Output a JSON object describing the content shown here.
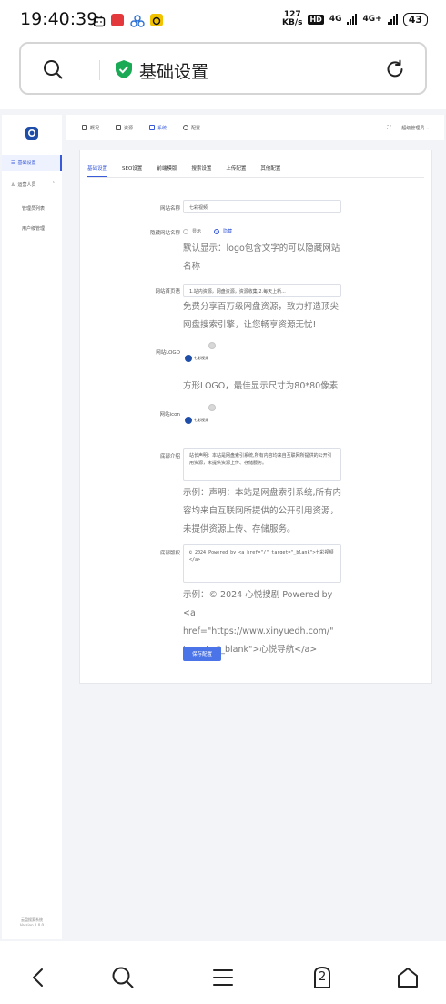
{
  "status_bar": {
    "time": "19:40:39",
    "speed_value": "127",
    "speed_unit": "KB/s",
    "hd": "HD",
    "net1": "4G",
    "net2": "4G+",
    "battery": "43"
  },
  "address_bar": {
    "title": "基础设置",
    "shield_color": "#1aaa55"
  },
  "sidebar": {
    "items": [
      {
        "label": "基础设置",
        "icon": "menu-icon"
      },
      {
        "label": "运营人员",
        "icon": "user-icon"
      }
    ],
    "sub_items": [
      "管理员列表",
      "用户级管理"
    ],
    "footer_line1": "云盘搜索系统",
    "footer_line2": "Version 1.0.0"
  },
  "topnav": {
    "items": [
      "概况",
      "资源",
      "系统",
      "配置"
    ],
    "active_index": 2,
    "user": "超级管理员"
  },
  "tabs": [
    "基础设置",
    "SEO设置",
    "前端模版",
    "搜索设置",
    "上传配置",
    "其他配置"
  ],
  "form": {
    "site_name": {
      "label": "网站名称",
      "value": "七彩视频"
    },
    "hide_name": {
      "label": "隐藏网站名称",
      "options": [
        "显示",
        "隐藏"
      ],
      "selected": "隐藏",
      "help": "默认显示：logo包含文字的可以隐藏网站名称"
    },
    "site_desc": {
      "label": "网站首页语",
      "value": "1.站内资源，网盘资源，资源收集 2.每天上新...",
      "help": "免费分享百万级网盘资源，致力打造顶尖网盘搜索引擎，让您畅享资源无忧!"
    },
    "logo": {
      "label": "网站LOGO",
      "mini_text": "七彩视频",
      "help": "方形LOGO，最佳显示尺寸为80*80像素"
    },
    "icon": {
      "label": "网站icon",
      "mini_text": "七彩视频"
    },
    "notice": {
      "label": "底部介绍",
      "value": "站长声明：本站是网盘索引系统,所有内容均来自互联网所提供的公开引用资源，未提供资源上传、存储服务。",
      "help": "示例：声明：本站是网盘索引系统,所有内容均来自互联网所提供的公开引用资源，未提供资源上传、存储服务。"
    },
    "copyright": {
      "label": "底部版权",
      "value": "© 2024 Powered by <a href=\"/\" target=\"_blank\">七彩视频</a>",
      "help": "示例：© 2024 心悦搜剧 Powered by <a href=\"https://www.xinyuedh.com/\" target=\"_blank\">心悦导航</a>"
    },
    "save_label": "保存配置"
  },
  "bottom_nav": {
    "tab_count": "2"
  },
  "colors": {
    "accent": "#3a5bd9",
    "button": "#4a74e8"
  }
}
